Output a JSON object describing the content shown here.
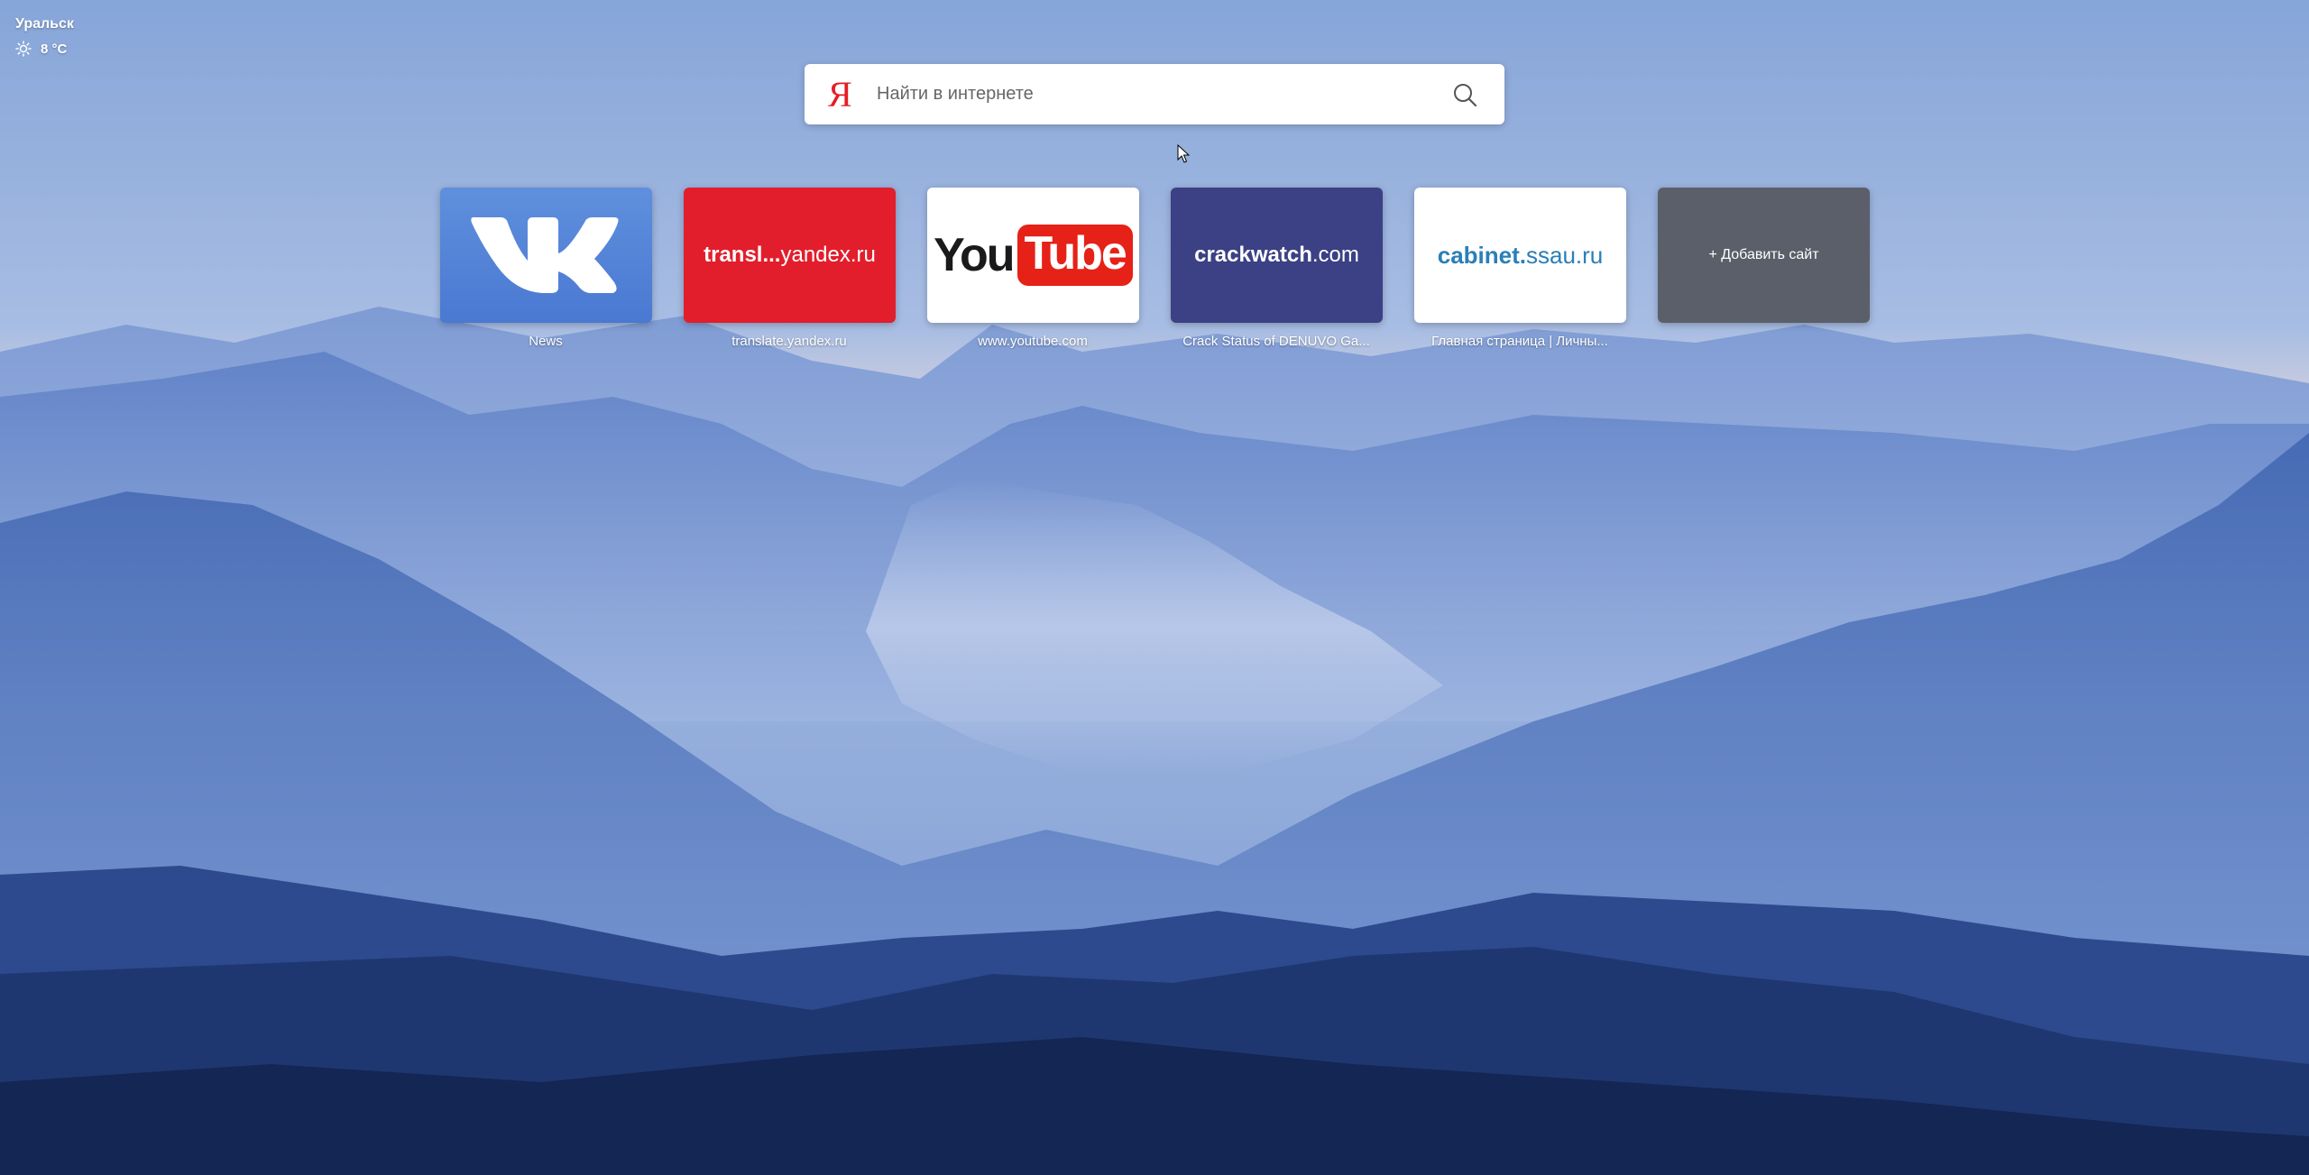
{
  "weather": {
    "city": "Уральск",
    "temperature": "8 °C",
    "icon": "sun-icon"
  },
  "search": {
    "logo": "Я",
    "placeholder": "Найти в интернете",
    "icon": "search-icon"
  },
  "tiles": [
    {
      "title": "News",
      "logo": "vk-logo",
      "color": "#4a79d2"
    },
    {
      "title": "translate.yandex.ru",
      "logo_text_a": "transl...",
      "logo_text_b": "yandex.ru",
      "color": "#e21e2c"
    },
    {
      "title": "www.youtube.com",
      "logo_text_a": "You",
      "logo_text_b": "Tube",
      "color": "#ffffff"
    },
    {
      "title": "Crack Status of DENUVO Ga...",
      "logo_text_a": "crackwatch",
      "logo_text_b": ".com",
      "color": "#3b4184"
    },
    {
      "title": "Главная страница | Личны...",
      "logo_text_a": "cabinet.",
      "logo_text_b": "ssau.ru",
      "color": "#ffffff"
    }
  ],
  "add_site": {
    "label": "+ Добавить сайт"
  }
}
